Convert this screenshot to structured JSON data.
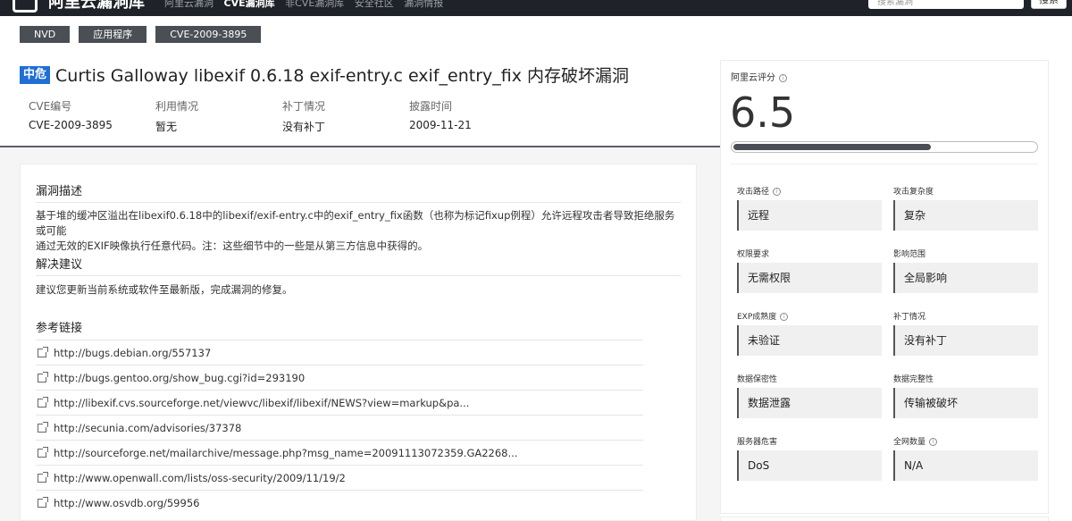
{
  "header": {
    "logo_text": "阿里云漏洞库",
    "nav": [
      "阿里云漏洞",
      "CVE漏洞库",
      "非CVE漏洞库",
      "安全社区",
      "漏洞情报"
    ],
    "search_placeholder": "搜索漏洞",
    "search_button": "搜索"
  },
  "tags": [
    "NVD",
    "应用程序",
    "CVE-2009-3895"
  ],
  "vuln": {
    "severity": "中危",
    "title": "Curtis Galloway libexif 0.6.18 exif-entry.c exif_entry_fix 内存破坏漏洞",
    "meta": [
      {
        "label": "CVE编号",
        "value": "CVE-2009-3895"
      },
      {
        "label": "利用情况",
        "value": "暂无"
      },
      {
        "label": "补丁情况",
        "value": "没有补丁"
      },
      {
        "label": "披露时间",
        "value": "2009-11-21"
      }
    ]
  },
  "description": {
    "title": "漏洞描述",
    "line1": "基于堆的缓冲区溢出在libexif0.6.18中的libexif/exif-entry.c中的exif_entry_fix函数（也称为标记fixup例程）允许远程攻击者导致拒绝服务或可能",
    "line2": "通过无效的EXIF映像执行任意代码。注：这些细节中的一些是从第三方信息中获得的。"
  },
  "solution": {
    "title": "解决建议",
    "text": "建议您更新当前系统或软件至最新版，完成漏洞的修复。"
  },
  "references": {
    "title": "参考链接",
    "links": [
      "http://bugs.debian.org/557137",
      "http://bugs.gentoo.org/show_bug.cgi?id=293190",
      "http://libexif.cvs.sourceforge.net/viewvc/libexif/libexif/NEWS?view=markup&pa...",
      "http://secunia.com/advisories/37378",
      "http://sourceforge.net/mailarchive/message.php?msg_name=20091113072359.GA2268...",
      "http://www.openwall.com/lists/oss-security/2009/11/19/2",
      "http://www.osvdb.org/59956"
    ]
  },
  "score_panel": {
    "label": "阿里云评分",
    "score": "6.5",
    "score_fraction": 0.65,
    "metrics": [
      {
        "label": "攻击路径",
        "value": "远程",
        "info": true
      },
      {
        "label": "攻击复杂度",
        "value": "复杂",
        "info": false
      },
      {
        "label": "权限要求",
        "value": "无需权限",
        "info": false
      },
      {
        "label": "影响范围",
        "value": "全局影响",
        "info": false
      },
      {
        "label": "EXP成熟度",
        "value": "未验证",
        "info": true
      },
      {
        "label": "补丁情况",
        "value": "没有补丁",
        "info": false
      },
      {
        "label": "数据保密性",
        "value": "数据泄露",
        "info": false
      },
      {
        "label": "数据完整性",
        "value": "传输被破坏",
        "info": false
      },
      {
        "label": "服务器危害",
        "value": "DoS",
        "info": false
      },
      {
        "label": "全网数量",
        "value": "N/A",
        "info": true
      }
    ]
  }
}
